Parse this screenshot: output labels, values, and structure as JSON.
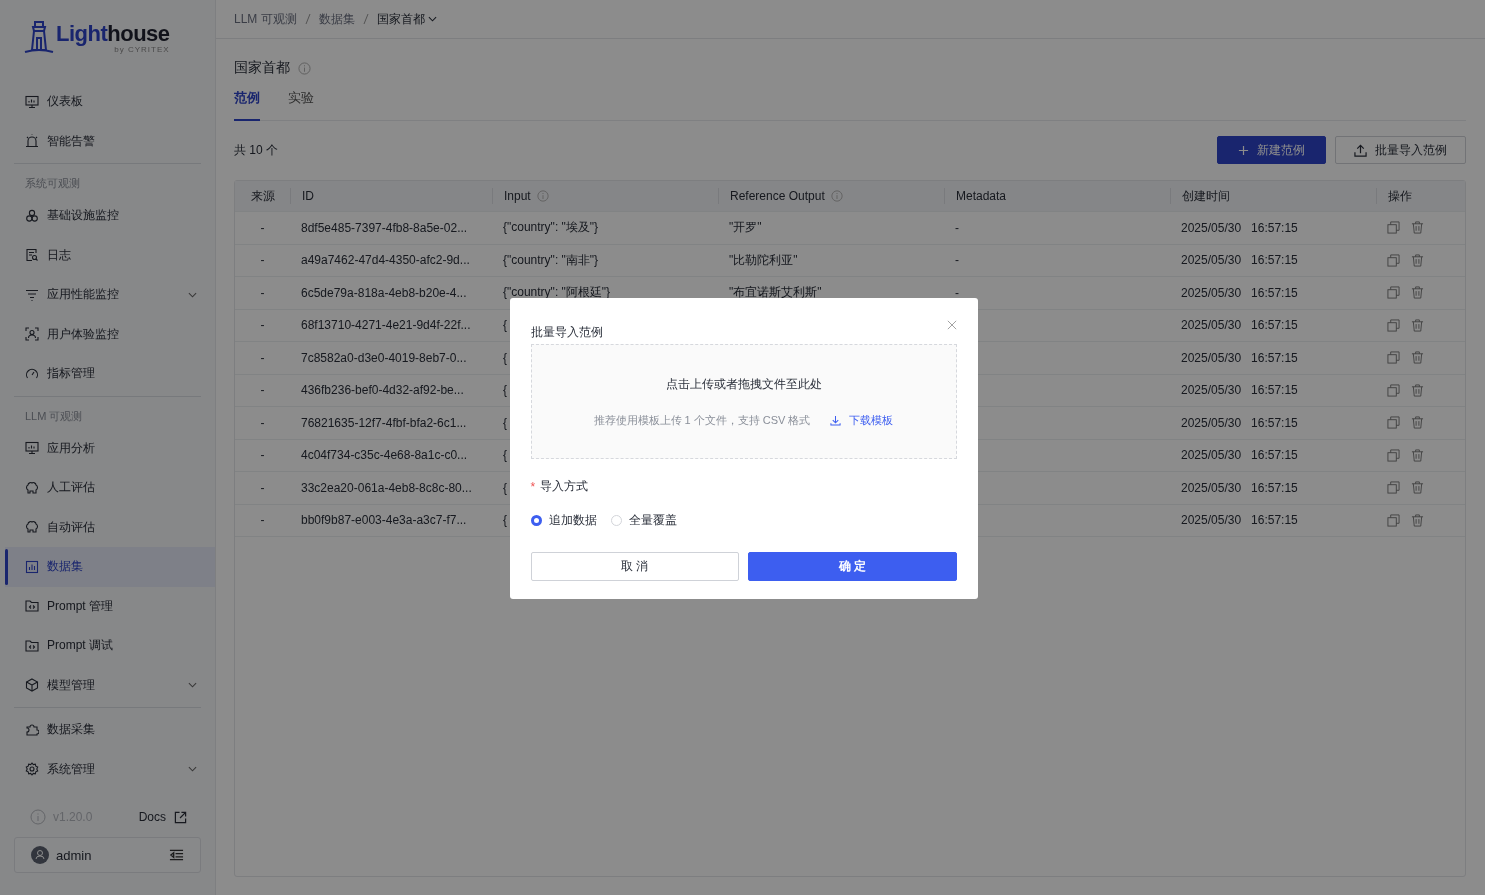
{
  "logo": {
    "name_part_1": "Light",
    "name_part_2": "house",
    "byline": "by CYRITEX"
  },
  "sidebar": {
    "groups": [
      {
        "items": [
          {
            "label": "仪表板",
            "selected": false,
            "expandable": false
          },
          {
            "label": "智能告警",
            "selected": false,
            "expandable": false
          }
        ]
      },
      {
        "label": "系统可观测",
        "items": [
          {
            "label": "基础设施监控",
            "selected": false,
            "expandable": false
          },
          {
            "label": "日志",
            "selected": false,
            "expandable": false
          },
          {
            "label": "应用性能监控",
            "selected": false,
            "expandable": true
          },
          {
            "label": "用户体验监控",
            "selected": false,
            "expandable": false
          },
          {
            "label": "指标管理",
            "selected": false,
            "expandable": false
          }
        ]
      },
      {
        "label": "LLM 可观测",
        "items": [
          {
            "label": "应用分析",
            "selected": false,
            "expandable": false
          },
          {
            "label": "人工评估",
            "selected": false,
            "expandable": false
          },
          {
            "label": "自动评估",
            "selected": false,
            "expandable": false
          },
          {
            "label": "数据集",
            "selected": true,
            "expandable": false
          },
          {
            "label": "Prompt 管理",
            "selected": false,
            "expandable": false
          },
          {
            "label": "Prompt 调试",
            "selected": false,
            "expandable": false
          },
          {
            "label": "模型管理",
            "selected": false,
            "expandable": true
          }
        ]
      },
      {
        "items": [
          {
            "label": "数据采集",
            "selected": false,
            "expandable": false
          },
          {
            "label": "系统管理",
            "selected": false,
            "expandable": true
          }
        ]
      }
    ],
    "version": "v1.20.0",
    "docs": "Docs",
    "user": "admin"
  },
  "breadcrumb": [
    "LLM 可观测",
    "数据集",
    "国家首都"
  ],
  "title": "国家首都",
  "tabs": [
    {
      "label": "范例",
      "selected": true
    },
    {
      "label": "实验",
      "selected": false
    }
  ],
  "count": "共 10 个",
  "toolbar": [
    {
      "label": "新建范例",
      "kind": "primary"
    },
    {
      "label": "批量导入范例",
      "kind": "import"
    }
  ],
  "table": {
    "columns": [
      {
        "label": "来源",
        "info": false
      },
      {
        "label": "ID",
        "info": false
      },
      {
        "label": "Input",
        "info": true
      },
      {
        "label": "Reference Output",
        "info": true
      },
      {
        "label": "Metadata",
        "info": false
      },
      {
        "label": "创建时间",
        "info": false
      },
      {
        "label": "操作",
        "info": false
      }
    ],
    "rows": [
      {
        "source": "-",
        "id": "8df5e485-7397-4fb8-8a5e-02...",
        "input": "{\"country\": \"埃及\"}",
        "reference_output": "\"开罗\"",
        "metadata": "-",
        "created": "2025/05/30   16:57:15"
      },
      {
        "source": "-",
        "id": "a49a7462-47d4-4350-afc2-9d...",
        "input": "{\"country\": \"南非\"}",
        "reference_output": "\"比勒陀利亚\"",
        "metadata": "-",
        "created": "2025/05/30   16:57:15"
      },
      {
        "source": "-",
        "id": "6c5de79a-818a-4eb8-b20e-4...",
        "input": "{\"country\": \"阿根廷\"}",
        "reference_output": "\"布宜诺斯艾利斯\"",
        "metadata": "-",
        "created": "2025/05/30   16:57:15"
      },
      {
        "source": "-",
        "id": "68f13710-4271-4e21-9d4f-22f...",
        "input": "{",
        "created": "2025/05/30   16:57:15"
      },
      {
        "source": "-",
        "id": "7c8582a0-d3e0-4019-8eb7-0...",
        "input": "{",
        "created": "2025/05/30   16:57:15"
      },
      {
        "source": "-",
        "id": "436fb236-bef0-4d32-af92-be...",
        "input": "{",
        "created": "2025/05/30   16:57:15"
      },
      {
        "source": "-",
        "id": "76821635-12f7-4fbf-bfa2-6c1...",
        "input": "{",
        "created": "2025/05/30   16:57:15"
      },
      {
        "source": "-",
        "id": "4c04f734-c35c-4e68-8a1c-c0...",
        "input": "{",
        "created": "2025/05/30   16:57:15"
      },
      {
        "source": "-",
        "id": "33c2ea20-061a-4eb8-8c8c-80...",
        "input": "{",
        "created": "2025/05/30   16:57:15"
      },
      {
        "source": "-",
        "id": "bb0f9b87-e003-4e3a-a3c7-f7...",
        "input": "{",
        "created": "2025/05/30   16:57:15"
      }
    ]
  },
  "modal": {
    "title": "批量导入范例",
    "upload": {
      "prompt": "点击上传或者拖拽文件至此处",
      "hint": "推荐使用模板上传 1 个文件，支持 CSV 格式",
      "link": "下载模板"
    },
    "field": {
      "label": "导入方式",
      "required_mark": "*",
      "options": [
        {
          "label": "追加数据",
          "selected": true
        },
        {
          "label": "全量覆盖",
          "selected": false
        }
      ]
    },
    "buttons": [
      {
        "label": "取 消",
        "kind": "cancel"
      },
      {
        "label": "确 定",
        "kind": "confirm"
      }
    ]
  }
}
